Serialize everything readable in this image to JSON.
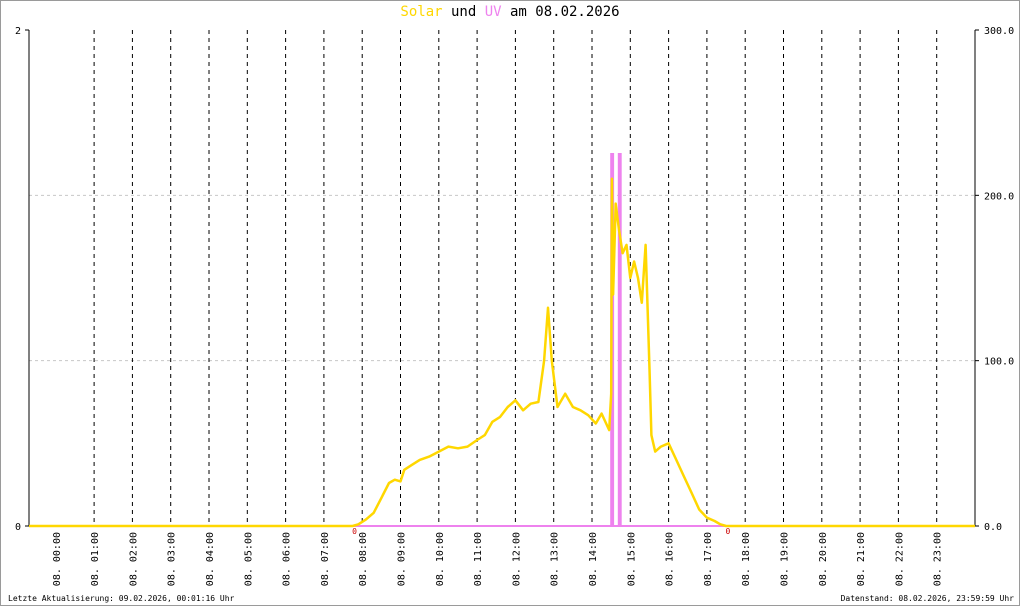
{
  "header": {
    "title_solar": "Solar",
    "title_und": " und ",
    "title_uv": "UV",
    "title_rest": " am 08.02.2026"
  },
  "footer": {
    "left": "Letzte Aktualisierung: 09.02.2026, 00:01:16 Uhr",
    "right": "Datenstand: 08.02.2026, 23:59:59 Uhr"
  },
  "colors": {
    "solar": "#ffd700",
    "uv": "#ee82ee",
    "baseline": "#f08080",
    "marker": "#cc0000"
  },
  "chart_data": {
    "type": "line",
    "title": "Solar und UV am 08.02.2026",
    "grid": true,
    "x_unit": "hour of day",
    "xlim": [
      -0.7,
      24.0
    ],
    "x_tick_labels": [
      "08. 00:00",
      "08. 01:00",
      "08. 02:00",
      "08. 03:00",
      "08. 04:00",
      "08. 05:00",
      "08. 06:00",
      "08. 07:00",
      "08. 08:00",
      "08. 09:00",
      "08. 10:00",
      "08. 11:00",
      "08. 12:00",
      "08. 13:00",
      "08. 14:00",
      "08. 15:00",
      "08. 16:00",
      "08. 17:00",
      "08. 18:00",
      "08. 19:00",
      "08. 20:00",
      "08. 21:00",
      "08. 22:00",
      "08. 23:00"
    ],
    "y_left": {
      "lim": [
        0,
        2
      ],
      "ticks": [
        "0",
        "2"
      ]
    },
    "y_right": {
      "lim": [
        0,
        300
      ],
      "ticks": [
        "0.0",
        "100.0",
        "200.0",
        "300.0"
      ]
    },
    "series": [
      {
        "name": "Solar",
        "axis": "right",
        "x": [
          -0.7,
          7.75,
          7.9,
          8.1,
          8.3,
          8.5,
          8.7,
          8.85,
          9.0,
          9.1,
          9.3,
          9.5,
          9.75,
          10.0,
          10.25,
          10.5,
          10.75,
          11.0,
          11.2,
          11.4,
          11.6,
          11.8,
          12.0,
          12.2,
          12.4,
          12.6,
          12.75,
          12.85,
          12.95,
          13.1,
          13.3,
          13.5,
          13.7,
          13.9,
          14.1,
          14.25,
          14.45,
          14.5,
          14.52,
          14.55,
          14.62,
          14.7,
          14.8,
          14.9,
          15.0,
          15.1,
          15.2,
          15.3,
          15.4,
          15.5,
          15.55,
          15.65,
          15.8,
          16.0,
          16.2,
          16.4,
          16.6,
          16.8,
          17.0,
          17.2,
          17.35,
          17.5,
          17.6,
          24.0
        ],
        "values": [
          0,
          0,
          1,
          4,
          8,
          17,
          26,
          28,
          27,
          34,
          37,
          40,
          42,
          45,
          48,
          47,
          48,
          52,
          55,
          63,
          66,
          72,
          76,
          70,
          74,
          75,
          100,
          132,
          100,
          72,
          80,
          72,
          70,
          67,
          62,
          68,
          58,
          80,
          210,
          140,
          195,
          180,
          165,
          170,
          150,
          160,
          150,
          135,
          170,
          95,
          55,
          45,
          48,
          50,
          40,
          30,
          20,
          10,
          5,
          3,
          1,
          0,
          0,
          0
        ]
      },
      {
        "name": "UV",
        "axis": "left",
        "x": [
          -0.7,
          14.5,
          14.5,
          14.55,
          14.55,
          14.7,
          14.7,
          14.75,
          14.75,
          14.8,
          14.8,
          24.0
        ],
        "values": [
          0,
          0,
          1.5,
          1.5,
          0,
          0,
          1.5,
          1.5,
          0,
          0,
          0,
          0
        ]
      }
    ],
    "markers": [
      {
        "label": "0",
        "x": 7.8
      },
      {
        "label": "0",
        "x": 17.55
      }
    ]
  }
}
